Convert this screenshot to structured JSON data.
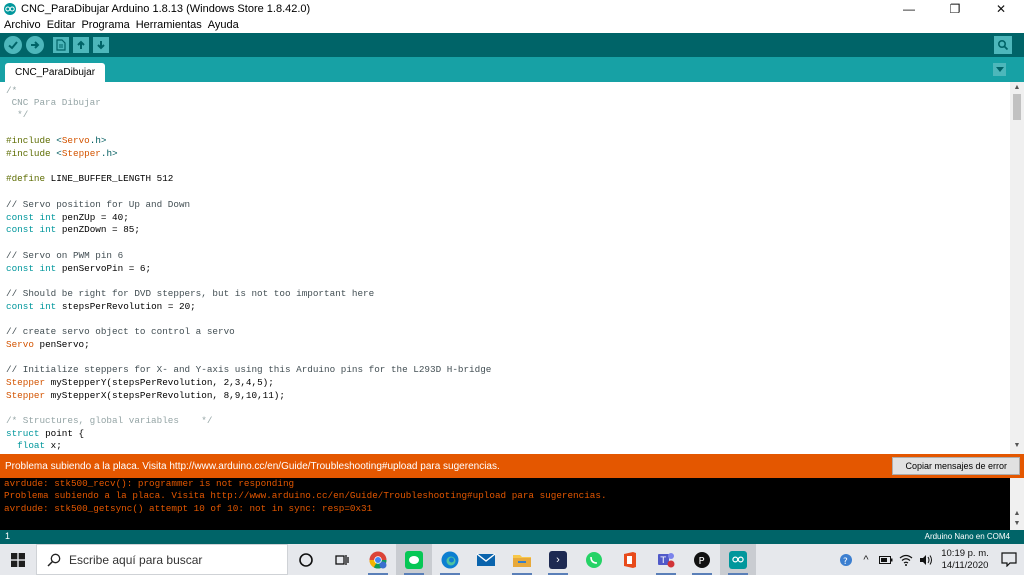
{
  "window": {
    "title": "CNC_ParaDibujar Arduino 1.8.13 (Windows Store 1.8.42.0)",
    "controls": [
      "—",
      "❐",
      "✕"
    ]
  },
  "menu": [
    "Archivo",
    "Editar",
    "Programa",
    "Herramientas",
    "Ayuda"
  ],
  "toolbar": {
    "icons": [
      "verify-icon",
      "upload-icon",
      "new-icon",
      "open-icon",
      "save-icon",
      "serial-monitor-icon"
    ]
  },
  "tabs": [
    {
      "label": "CNC_ParaDibujar"
    }
  ],
  "editor": {
    "lines": [
      "/*",
      " CNC Para Dibujar",
      "  */",
      "",
      "#include <Servo.h>",
      "#include <Stepper.h>",
      "",
      "#define LINE_BUFFER_LENGTH 512",
      "",
      "// Servo position for Up and Down",
      "const int penZUp = 40;",
      "const int penZDown = 85;",
      "",
      "// Servo on PWM pin 6",
      "const int penServoPin = 6;",
      "",
      "// Should be right for DVD steppers, but is not too important here",
      "const int stepsPerRevolution = 20;",
      "",
      "// create servo object to control a servo",
      "Servo penServo;",
      "",
      "// Initialize steppers for X- and Y-axis using this Arduino pins for the L293D H-bridge",
      "Stepper myStepperY(stepsPerRevolution, 2,3,4,5);",
      "Stepper myStepperX(stepsPerRevolution, 8,9,10,11);",
      "",
      "/* Structures, global variables    */",
      "struct point {",
      "  float x;"
    ]
  },
  "status": {
    "message": "Problema subiendo a la placa. Visita http://www.arduino.cc/en/Guide/Troubleshooting#upload para sugerencias.",
    "copy_button": "Copiar mensajes de error",
    "color": "#e45700"
  },
  "console": {
    "lines": [
      "avrdude: stk500_recv(): programmer is not responding",
      "Problema subiendo a la placa. Visita http://www.arduino.cc/en/Guide/Troubleshooting#upload para sugerencias.",
      "avrdude: stk500_getsync() attempt 10 of 10: not in sync: resp=0x31"
    ]
  },
  "footer": {
    "line_number": "1",
    "board": "Arduino Nano en COM4"
  },
  "taskbar": {
    "search_placeholder": "Escribe aquí para buscar",
    "clock_time": "10:19 p. m.",
    "clock_date": "14/11/2020",
    "apps": [
      "cortana-icon",
      "task-view-icon",
      "chrome-icon",
      "line-app-icon",
      "edge-icon",
      "mail-icon",
      "file-explorer-icon",
      "powershell-icon",
      "whatsapp-icon",
      "office-icon",
      "teams-icon",
      "app-icon",
      "arduino-icon"
    ]
  },
  "colors": {
    "toolbar": "#006468",
    "tabbar": "#17a1a5",
    "button": "#4db7bb"
  }
}
